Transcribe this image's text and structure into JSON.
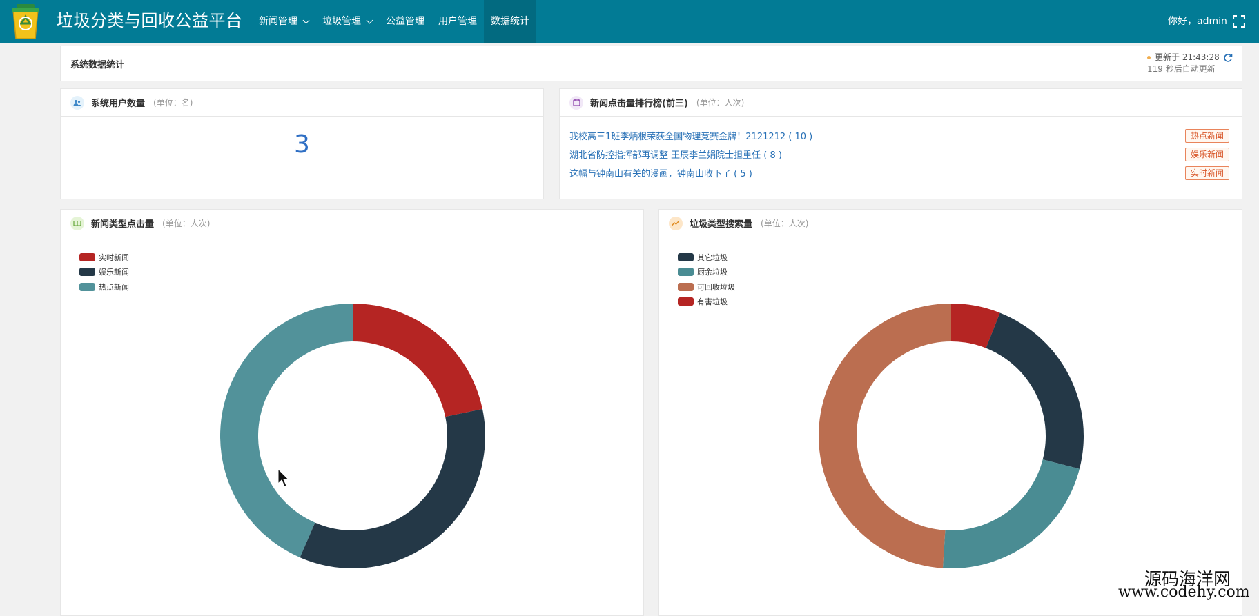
{
  "header": {
    "title": "垃圾分类与回收公益平台",
    "nav": [
      {
        "label": "新闻管理",
        "dropdown": true
      },
      {
        "label": "垃圾管理",
        "dropdown": true
      },
      {
        "label": "公益管理",
        "dropdown": false
      },
      {
        "label": "用户管理",
        "dropdown": false
      },
      {
        "label": "数据统计",
        "dropdown": false,
        "active": true
      }
    ],
    "greeting": "你好，admin"
  },
  "stats_bar": {
    "title": "系统数据统计",
    "updated": "更新于 21:43:28",
    "auto_refresh": "119 秒后自动更新"
  },
  "user_count": {
    "title": "系统用户数量",
    "unit": "(单位：名)",
    "value": "3"
  },
  "news_ranking": {
    "title": "新闻点击量排行榜(前三)",
    "unit": "(单位：人次)",
    "items": [
      {
        "text": "我校高三1班李炳根荣获全国物理竞赛金牌！2121212 ( 10 )",
        "tag": "热点新闻"
      },
      {
        "text": "湖北省防控指挥部再调整 王辰李兰娟院士担重任 ( 8 )",
        "tag": "娱乐新闻"
      },
      {
        "text": "这幅与钟南山有关的漫画，钟南山收下了 ( 5 )",
        "tag": "实时新闻"
      }
    ]
  },
  "news_type_card": {
    "title": "新闻类型点击量",
    "unit": "(单位：人次)"
  },
  "garbage_type_card": {
    "title": "垃圾类型搜索量",
    "unit": "(单位：人次)"
  },
  "colors": {
    "nav_bg": "#027b95",
    "red": "#b52523",
    "dark": "#243847",
    "teal": "#52929a",
    "teal2": "#4a8c93",
    "brown": "#bb6e50",
    "link": "#2770b6"
  },
  "chart_data": [
    {
      "type": "pie",
      "legend": [
        "实时新闻",
        "娱乐新闻",
        "热点新闻"
      ],
      "legend_placement": "top-left",
      "start_angle_deg": 0,
      "slices": [
        {
          "name": "实时新闻",
          "value": 5,
          "color": "#b52523"
        },
        {
          "name": "娱乐新闻",
          "value": 8,
          "color": "#243847"
        },
        {
          "name": "热点新闻",
          "value": 10,
          "color": "#52929a"
        }
      ]
    },
    {
      "type": "pie",
      "legend": [
        "其它垃圾",
        "厨余垃圾",
        "可回收垃圾",
        "有害垃圾"
      ],
      "legend_placement": "top-left",
      "start_angle_deg": 0,
      "slices": [
        {
          "name": "有害垃圾",
          "value": 6,
          "color": "#b52523"
        },
        {
          "name": "其它垃圾",
          "value": 23,
          "color": "#243847"
        },
        {
          "name": "厨余垃圾",
          "value": 22,
          "color": "#4a8c93"
        },
        {
          "name": "可回收垃圾",
          "value": 49,
          "color": "#bb6e50"
        }
      ]
    }
  ],
  "watermark": {
    "line1": "源码海洋网",
    "line2": "www.codehy.com"
  }
}
